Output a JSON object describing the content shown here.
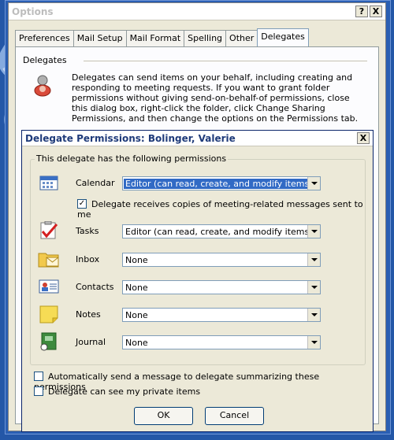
{
  "options_dialog": {
    "title": "Options",
    "help_button": "?",
    "close_button": "X",
    "tabs": [
      {
        "label": "Preferences"
      },
      {
        "label": "Mail Setup"
      },
      {
        "label": "Mail Format"
      },
      {
        "label": "Spelling"
      },
      {
        "label": "Other"
      },
      {
        "label": "Delegates"
      }
    ],
    "section_label": "Delegates",
    "description": "Delegates can send items on your behalf, including creating and responding to meeting requests. If you want to grant folder permissions without giving send-on-behalf-of permissions, close this dialog box, right-click the folder, click Change Sharing Permissions, and then change the options on the Permissions tab."
  },
  "permissions_dialog": {
    "title": "Delegate Permissions: Bolinger, Valerie",
    "close_button": "X",
    "group_label": "This delegate has the following permissions",
    "rows": [
      {
        "label": "Calendar",
        "value": "Editor (can read, create, and modify items)"
      },
      {
        "label": "Tasks",
        "value": "Editor (can read, create, and modify items)"
      },
      {
        "label": "Inbox",
        "value": "None"
      },
      {
        "label": "Contacts",
        "value": "None"
      },
      {
        "label": "Notes",
        "value": "None"
      },
      {
        "label": "Journal",
        "value": "None"
      }
    ],
    "meeting_copies_label": "Delegate receives copies of meeting-related messages sent to me",
    "meeting_copies_checked": true,
    "auto_send_label": "Automatically send a message to delegate summarizing these permissions",
    "auto_send_checked": false,
    "private_items_label": "Delegate can see my private items",
    "private_items_checked": false,
    "ok_label": "OK",
    "cancel_label": "Cancel"
  },
  "colors": {
    "background_blue": "#2457a7",
    "dialog_face": "#ece9d8",
    "selection_blue": "#316ac5"
  }
}
